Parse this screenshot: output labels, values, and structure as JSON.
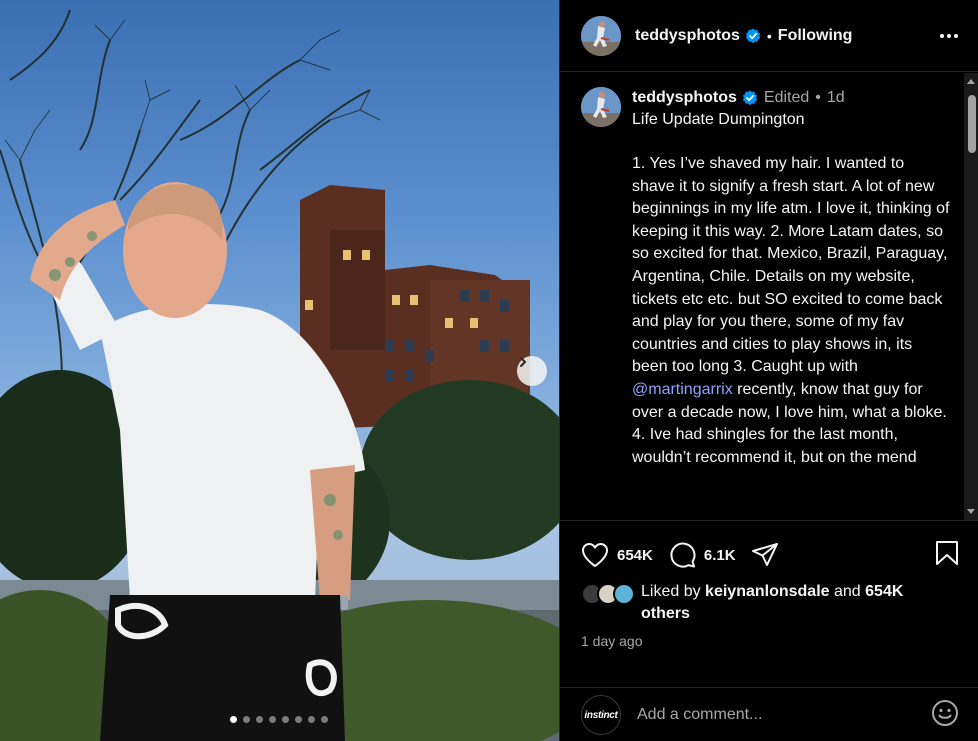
{
  "post": {
    "username": "teddysphotos",
    "follow_state": "Following",
    "separator": "•",
    "edited_label": "Edited",
    "time_short": "1d",
    "caption_title": "Life Update Dumpington",
    "caption_part1": "1. Yes I’ve shaved my hair. I wanted to shave it to signify a fresh start. A lot of new beginnings in my life atm. I love it, thinking of keeping it this way. 2. More Latam dates, so so excited for that. Mexico, Brazil, Paraguay, Argentina, Chile. Details on my website, tickets etc etc. but SO excited to come back and play for you there, some of my fav countries and cities to play shows in, its been too long 3. Caught up with ",
    "mention": "@martingarrix",
    "caption_part2": " recently, know that guy for over a decade now, I love him, what a bloke. 4. Ive had shingles for the last month, wouldn’t recommend it, but on the mend"
  },
  "carousel": {
    "total": 8,
    "current": 1
  },
  "engagement": {
    "like_count": "654K",
    "comment_count": "6.1K",
    "liked_by_prefix": "Liked by",
    "liked_by_user": "keiynanlonsdale",
    "liked_by_and": "and",
    "liked_by_others": "654K others",
    "posted_ago": "1 day ago"
  },
  "comment_box": {
    "placeholder": "Add a comment...",
    "avatar_text": "instinct"
  },
  "colors": {
    "verified": "#0095f6",
    "mention": "#8ea2ff",
    "muted": "#a8a8a8"
  },
  "icons": [
    "more-options-icon",
    "verified-badge-icon",
    "heart-icon",
    "comment-icon",
    "share-icon",
    "bookmark-icon",
    "emoji-icon",
    "chevron-right-icon"
  ]
}
